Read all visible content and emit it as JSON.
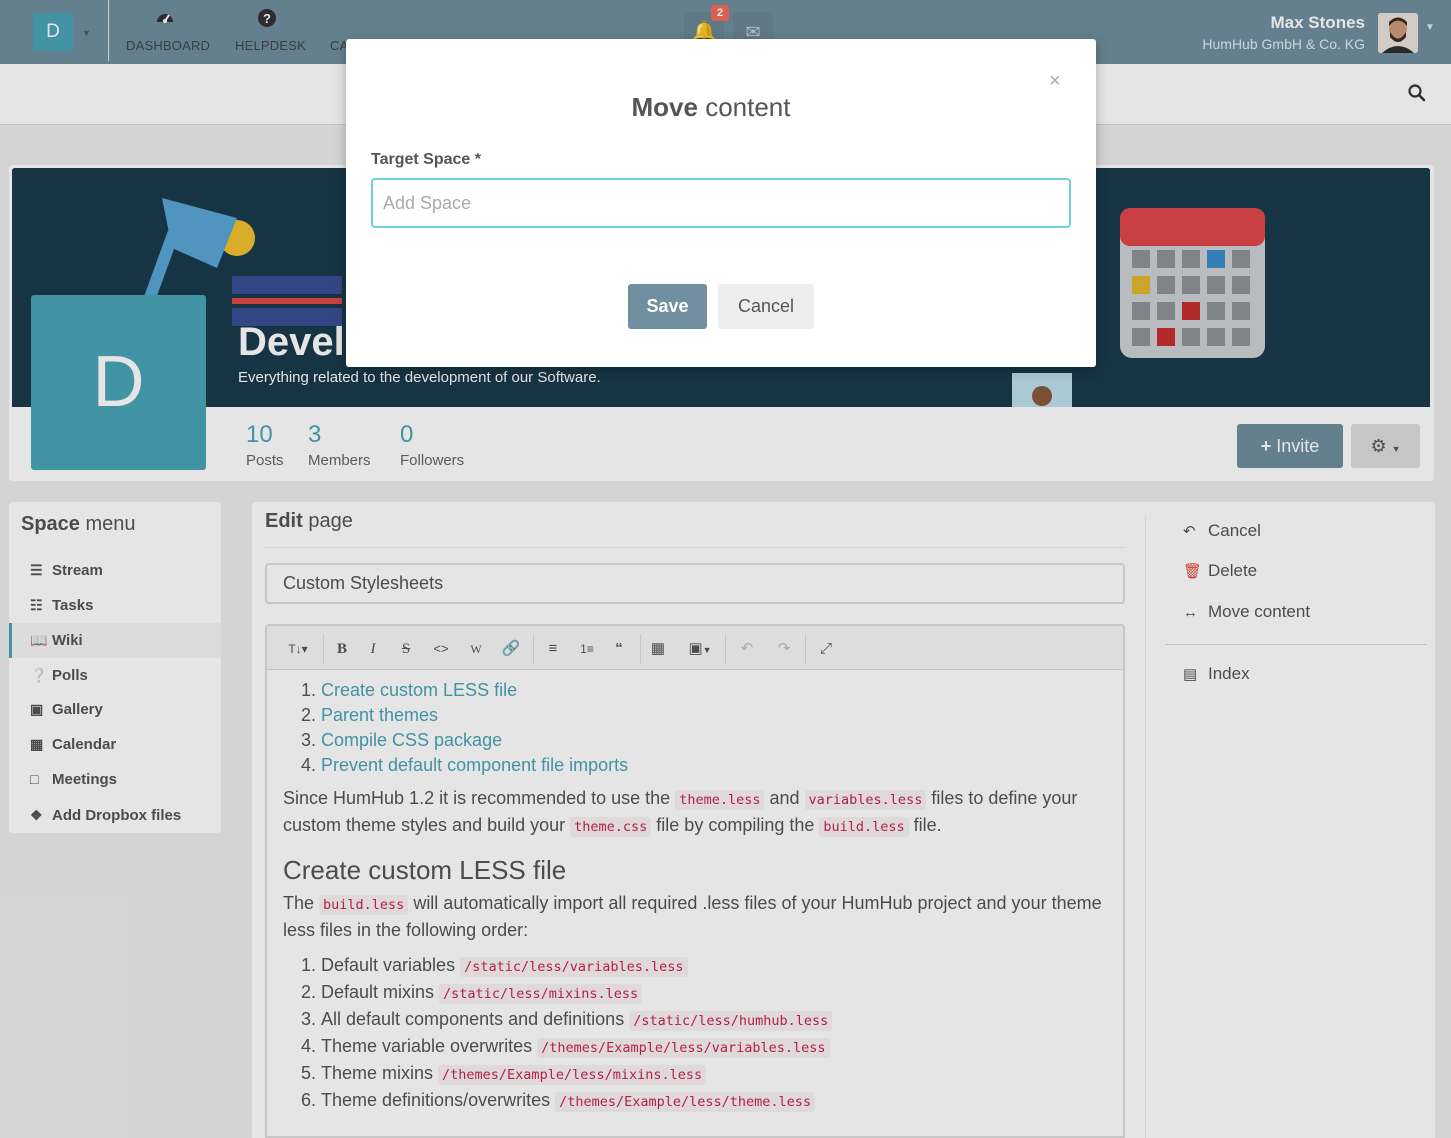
{
  "topbar": {
    "notification_count": "2",
    "user_name": "Max Stones",
    "user_company": "HumHub GmbH & Co. KG"
  },
  "navbar": {
    "space_initial": "D",
    "items": [
      {
        "label": "DASHBOARD",
        "icon": "dashboard-icon"
      },
      {
        "label": "HELPDESK",
        "icon": "question-circle-icon"
      },
      {
        "label": "CA",
        "icon": "calendar-icon"
      }
    ]
  },
  "space": {
    "initial": "D",
    "title": "Devel",
    "description": "Everything related to the development of our Software.",
    "stats": [
      {
        "value": "10",
        "label": "Posts"
      },
      {
        "value": "3",
        "label": "Members"
      },
      {
        "value": "0",
        "label": "Followers"
      }
    ],
    "invite_label": "Invite"
  },
  "space_menu": {
    "heading_bold": "Space",
    "heading_rest": "menu",
    "items": [
      {
        "label": "Stream",
        "icon": "bars-icon"
      },
      {
        "label": "Tasks",
        "icon": "tasks-icon"
      },
      {
        "label": "Wiki",
        "icon": "book-icon"
      },
      {
        "label": "Polls",
        "icon": "question-circle-icon"
      },
      {
        "label": "Gallery",
        "icon": "image-icon"
      },
      {
        "label": "Calendar",
        "icon": "calendar-icon"
      },
      {
        "label": "Meetings",
        "icon": "calendar-o-icon"
      },
      {
        "label": "Add Dropbox files",
        "icon": "dropbox-icon"
      }
    ],
    "active_index": 2
  },
  "edit": {
    "heading_bold": "Edit",
    "heading_rest": "page",
    "title_value": "Custom Stylesheets",
    "toc": [
      "Create custom LESS file",
      "Parent themes",
      "Compile CSS package",
      "Prevent default component file imports"
    ],
    "p1": {
      "t1": "Since HumHub 1.2 it is recommended to use the ",
      "c1": "theme.less",
      "t2": " and ",
      "c2": "variables.less",
      "t3": " files to define your custom theme styles and build your ",
      "c3": "theme.css",
      "t4": " file by compiling the ",
      "c4": "build.less",
      "t5": " file."
    },
    "h2": "Create custom LESS file",
    "p2": {
      "t1": "The ",
      "c1": "build.less",
      "t2": " will automatically import all required .less files of your HumHub project and your theme less files in the following order:"
    },
    "import_list": [
      {
        "text": "Default variables ",
        "code": "/static/less/variables.less"
      },
      {
        "text": "Default mixins ",
        "code": "/static/less/mixins.less"
      },
      {
        "text": "All default components and definitions ",
        "code": "/static/less/humhub.less"
      },
      {
        "text": "Theme variable overwrites ",
        "code": "/themes/Example/less/variables.less"
      },
      {
        "text": "Theme mixins ",
        "code": "/themes/Example/less/mixins.less"
      },
      {
        "text": "Theme definitions/overwrites ",
        "code": "/themes/Example/less/theme.less"
      }
    ]
  },
  "sidebar": {
    "cancel": "Cancel",
    "delete": "Delete",
    "move": "Move content",
    "index": "Index"
  },
  "modal": {
    "title_bold": "Move",
    "title_rest": "content",
    "close": "×",
    "label": "Target Space *",
    "placeholder": "Add Space",
    "save": "Save",
    "cancel": "Cancel"
  },
  "colors": {
    "accent": "#4aa4b6",
    "primary": "#708fa0",
    "danger": "#e0463a",
    "input_focus": "#6fd1dc"
  }
}
